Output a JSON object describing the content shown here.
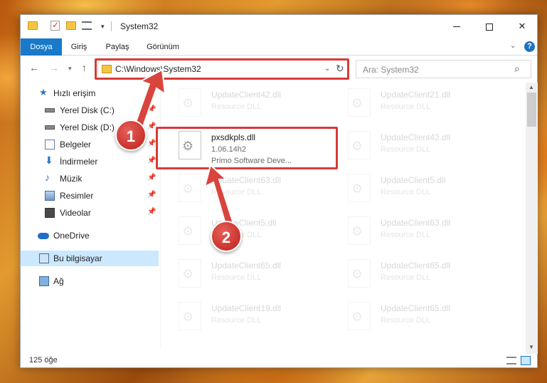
{
  "window": {
    "title": "System32"
  },
  "ribbon": {
    "tabs": [
      "Dosya",
      "Giriş",
      "Paylaş",
      "Görünüm"
    ]
  },
  "address": {
    "path": "C:\\Windows\\System32"
  },
  "search": {
    "placeholder": "Ara: System32"
  },
  "sidebar": {
    "items": [
      {
        "label": "Hızlı erişim"
      },
      {
        "label": "Yerel Disk (C:)"
      },
      {
        "label": "Yerel Disk (D:)"
      },
      {
        "label": "Belgeler"
      },
      {
        "label": "İndirmeler"
      },
      {
        "label": "Müzik"
      },
      {
        "label": "Resimler"
      },
      {
        "label": "Videolar"
      },
      {
        "label": "OneDrive"
      },
      {
        "label": "Bu bilgisayar"
      },
      {
        "label": "Ağ"
      }
    ]
  },
  "files": {
    "left": [
      {
        "name": "UpdateClient42.dll",
        "desc": "Resource DLL"
      },
      {
        "name": "pxsdkpls.dll",
        "version": "1.06.14h2",
        "company": "Primo Software Deve..."
      },
      {
        "name": "UpdateClient63.dll",
        "desc": "Resource DLL"
      },
      {
        "name": "UpdateClient5.dll",
        "desc": "Resource DLL"
      },
      {
        "name": "UpdateClient65.dll",
        "desc": "Resource DLL"
      },
      {
        "name": "UpdateClient19.dll",
        "desc": "Resource DLL"
      }
    ],
    "right": [
      {
        "name": "UpdateClient21.dll",
        "desc": "Resource DLL"
      },
      {
        "name": "UpdateClient42.dll",
        "desc": "Resource DLL"
      },
      {
        "name": "UpdateClient5.dll",
        "desc": "Resource DLL"
      },
      {
        "name": "UpdateClient63.dll",
        "desc": "Resource DLL"
      },
      {
        "name": "UpdateClient65.dll",
        "desc": "Resource DLL"
      },
      {
        "name": "UpdateClient65.dll",
        "desc": "Resource DLL"
      }
    ]
  },
  "status": {
    "count": "125 öğe"
  },
  "annotations": {
    "step1": "1",
    "step2": "2"
  },
  "colors": {
    "accent": "#1979ca",
    "highlight": "#d63c36",
    "selection": "#cce8ff"
  }
}
